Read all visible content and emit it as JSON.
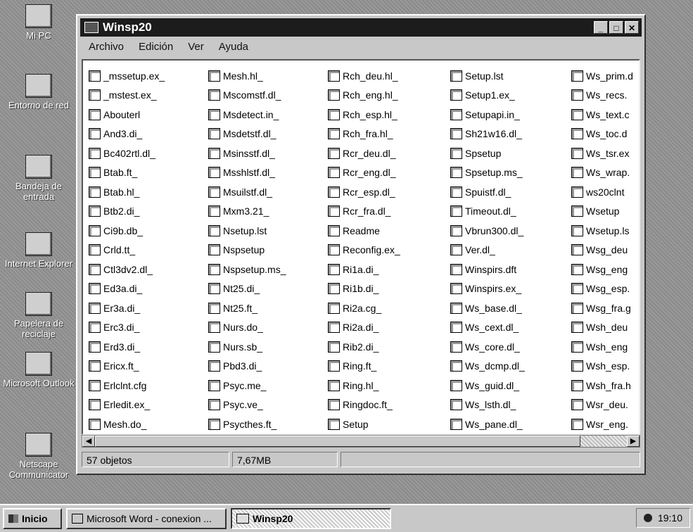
{
  "desktop": {
    "icons": [
      {
        "label": "Mi PC",
        "icon": "computer-icon"
      },
      {
        "label": "Entorno de red",
        "icon": "network-icon"
      },
      {
        "label": "Bandeja de entrada",
        "icon": "inbox-icon"
      },
      {
        "label": "Internet Explorer",
        "icon": "internet-explorer-icon"
      },
      {
        "label": "Papelera de reciclaje",
        "icon": "recycle-bin-icon"
      },
      {
        "label": "Microsoft Outlook",
        "icon": "outlook-icon"
      },
      {
        "label": "Netscape Communicator",
        "icon": "netscape-icon"
      }
    ]
  },
  "window": {
    "title": "Winsp20",
    "menu": [
      "Archivo",
      "Edición",
      "Ver",
      "Ayuda"
    ],
    "files": {
      "col1": [
        "_mssetup.ex_",
        "_mstest.ex_",
        "Abouterl",
        "And3.di_",
        "Bc402rtl.dl_",
        "Btab.ft_",
        "Btab.hl_",
        "Btb2.di_",
        "Ci9b.db_",
        "Crld.tt_",
        "Ctl3dv2.dl_",
        "Ed3a.di_",
        "Er3a.di_",
        "Erc3.di_",
        "Erd3.di_",
        "Ericx.ft_",
        "Erlclnt.cfg",
        "Erledit.ex_",
        "Mesh.do_"
      ],
      "col2": [
        "Mesh.hl_",
        "Mscomstf.dl_",
        "Msdetect.in_",
        "Msdetstf.dl_",
        "Msinsstf.dl_",
        "Msshlstf.dl_",
        "Msuilstf.dl_",
        "Mxm3.21_",
        "Nsetup.lst",
        "Nspsetup",
        "Nspsetup.ms_",
        "Nt25.di_",
        "Nt25.ft_",
        "Nurs.do_",
        "Nurs.sb_",
        "Pbd3.di_",
        "Psyc.me_",
        "Psyc.ve_",
        "Psycthes.ft_"
      ],
      "col3": [
        "Rch_deu.hl_",
        "Rch_eng.hl_",
        "Rch_esp.hl_",
        "Rch_fra.hl_",
        "Rcr_deu.dl_",
        "Rcr_eng.dl_",
        "Rcr_esp.dl_",
        "Rcr_fra.dl_",
        "Readme",
        "Reconfig.ex_",
        "Ri1a.di_",
        "Ri1b.di_",
        "Ri2a.cg_",
        "Ri2a.di_",
        "Rib2.di_",
        "Ring.ft_",
        "Ring.hl_",
        "Ringdoc.ft_",
        "Setup"
      ],
      "col4": [
        "Setup.lst",
        "Setup1.ex_",
        "Setupapi.in_",
        "Sh21w16.dl_",
        "Spsetup",
        "Spsetup.ms_",
        "Spuistf.dl_",
        "Timeout.dl_",
        "Vbrun300.dl_",
        "Ver.dl_",
        "Winspirs.dft",
        "Winspirs.ex_",
        "Ws_base.dl_",
        "Ws_cext.dl_",
        "Ws_core.dl_",
        "Ws_dcmp.dl_",
        "Ws_guid.dl_",
        "Ws_lsth.dl_",
        "Ws_pane.dl_"
      ],
      "col5": [
        "Ws_prim.d",
        "Ws_recs.",
        "Ws_text.c",
        "Ws_toc.d",
        "Ws_tsr.ex",
        "Ws_wrap.",
        "ws20clnt",
        "Wsetup",
        "Wsetup.ls",
        "Wsg_deu",
        "Wsg_eng",
        "Wsg_esp.",
        "Wsg_fra.g",
        "Wsh_deu",
        "Wsh_eng",
        "Wsh_esp.",
        "Wsh_fra.h",
        "Wsr_deu.",
        "Wsr_eng."
      ]
    },
    "status": {
      "count": "57 objetos",
      "size": "7,67MB"
    }
  },
  "taskbar": {
    "start": "Inicio",
    "word": "Microsoft Word - conexion ...",
    "winsp": "Winsp20",
    "clock": "19:10"
  }
}
